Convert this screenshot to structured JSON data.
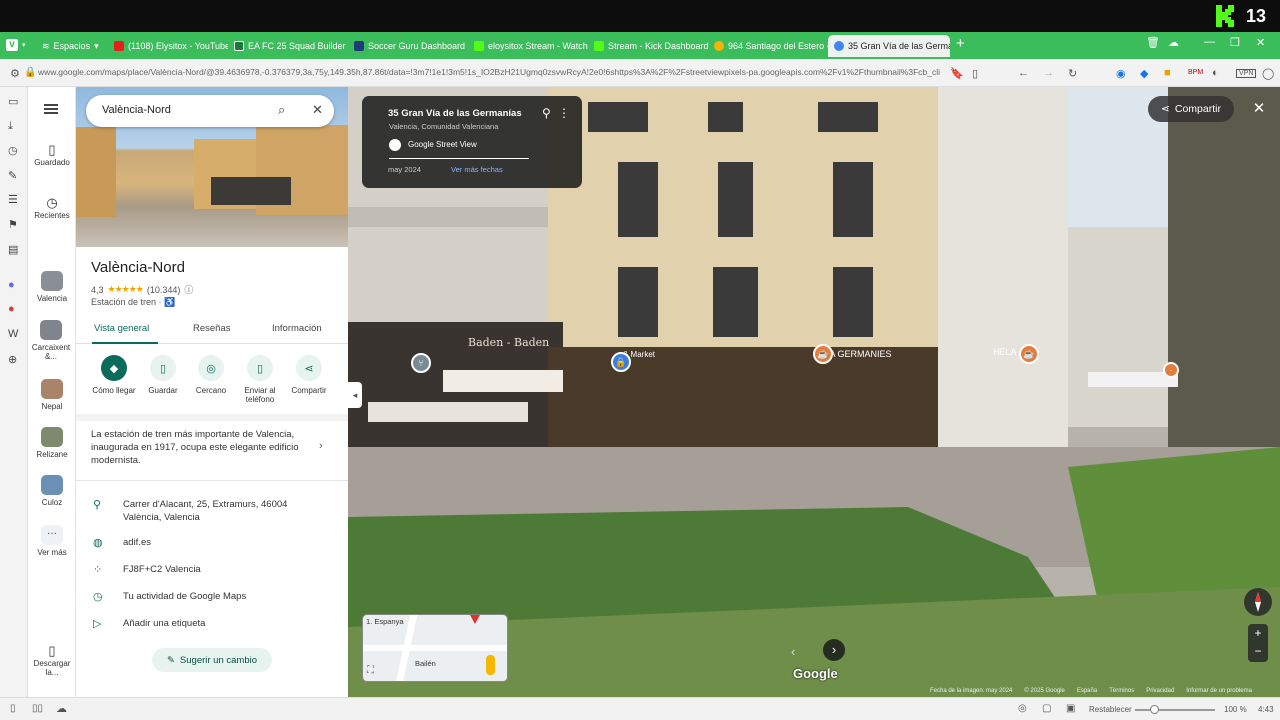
{
  "os_bar": {
    "count": "13"
  },
  "browser": {
    "tabs": [
      {
        "label": "Espacios",
        "icon": "spaces-icon"
      },
      {
        "label": "(1108) Elysitox - YouTube",
        "icon": "youtube-icon"
      },
      {
        "label": "EA FC 25 Squad Builder | F",
        "icon": "futbin-icon"
      },
      {
        "label": "Soccer Guru Dashboard",
        "icon": "soccer-icon"
      },
      {
        "label": "eloysitox Stream - Watch L",
        "icon": "kick-icon"
      },
      {
        "label": "Stream - Kick Dashboard",
        "icon": "kick-icon"
      },
      {
        "label": "964 Santiago del Estero - G",
        "icon": "maps-icon"
      },
      {
        "label": "35 Gran Vía de las Germani",
        "icon": "maps-icon"
      }
    ],
    "url": "www.google.com/maps/place/València-Nord/@39.4636978,-0.376379,3a,75y,149.35h,87.86t/data=!3m7!1e1!3m5!1s_IO2BzH21Ugmq0zsvwRcyA!2e0!6shttps%3A%2F%2Fstreetviewpixels-pa.googleapis.com%2Fv1%2Fthumbnail%3Fcb_client..."
  },
  "rail": {
    "saved": "Guardado",
    "recent": "Recientes",
    "items": [
      {
        "label": "Valencia"
      },
      {
        "label": "Carcaixent &..."
      },
      {
        "label": "Nepal"
      },
      {
        "label": "Relizane"
      },
      {
        "label": "Culoz"
      }
    ],
    "more": "Ver más",
    "download": "Descargar la..."
  },
  "panel": {
    "search_value": "València-Nord",
    "title": "València-Nord",
    "rating": "4,3",
    "stars": "★★★★★",
    "reviews": "(10.344)",
    "type": "Estación de tren · ♿",
    "tabs": [
      "Vista general",
      "Reseñas",
      "Información"
    ],
    "actions": [
      "Cómo llegar",
      "Guardar",
      "Cercano",
      "Enviar al teléfono",
      "Compartir"
    ],
    "description": "La estación de tren más importante de Valencia, inaugurada en 1917, ocupa este elegante edificio modernista.",
    "address": "Carrer d'Alacant, 25, Extramurs, 46004 València, Valencia",
    "website": "adif.es",
    "plus_code": "FJ8F+C2 Valencia",
    "activity": "Tu actividad de Google Maps",
    "label": "Añadir una etiqueta",
    "suggest": "Sugerir un cambio"
  },
  "streetview": {
    "card_title": "35 Gran Vía de las Germanías",
    "card_subtitle": "Valencia, Comunidad Valenciana",
    "card_source": "Google Street View",
    "card_date": "may 2024",
    "card_more_dates": "Ver más fechas",
    "share": "Compartir",
    "sign_baden": "Baden - Baden",
    "sign_market": "& Market",
    "sign_germanias": "NA GERMANIES",
    "sign_hela": "HELA",
    "watermark": "Google",
    "minimap_label_top": "1. Espanya",
    "minimap_label_bottom": "Bailén",
    "footer": [
      "Fecha de la imagen: may 2024",
      "© 2025 Google",
      "España",
      "Términos",
      "Privacidad",
      "Informar de un problema"
    ]
  },
  "status": {
    "reset": "Restablecer",
    "zoom": "100 %",
    "time": "4:43"
  }
}
